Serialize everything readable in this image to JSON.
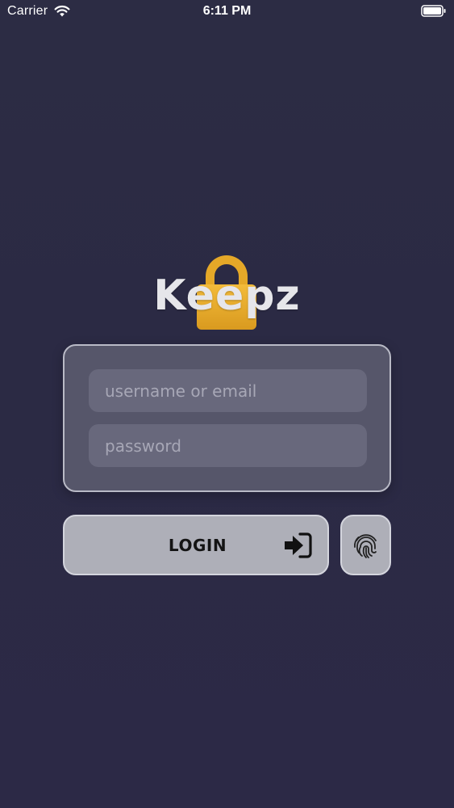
{
  "status_bar": {
    "carrier": "Carrier",
    "time": "6:11 PM",
    "wifi_icon": "wifi-icon",
    "battery_icon": "battery-full-icon"
  },
  "logo": {
    "title": "Keepz",
    "icon": "padlock-icon",
    "icon_color": "#e8a92c"
  },
  "form": {
    "username": {
      "placeholder": "username or email",
      "value": ""
    },
    "password": {
      "placeholder": "password",
      "value": ""
    }
  },
  "actions": {
    "login_label": "LOGIN",
    "login_icon": "sign-in-icon",
    "fingerprint_icon": "fingerprint-icon"
  },
  "colors": {
    "background": "#2c2b45",
    "card": "#56566a",
    "field": "#68687c",
    "button": "#aeafb8",
    "accent": "#e8a92c"
  }
}
